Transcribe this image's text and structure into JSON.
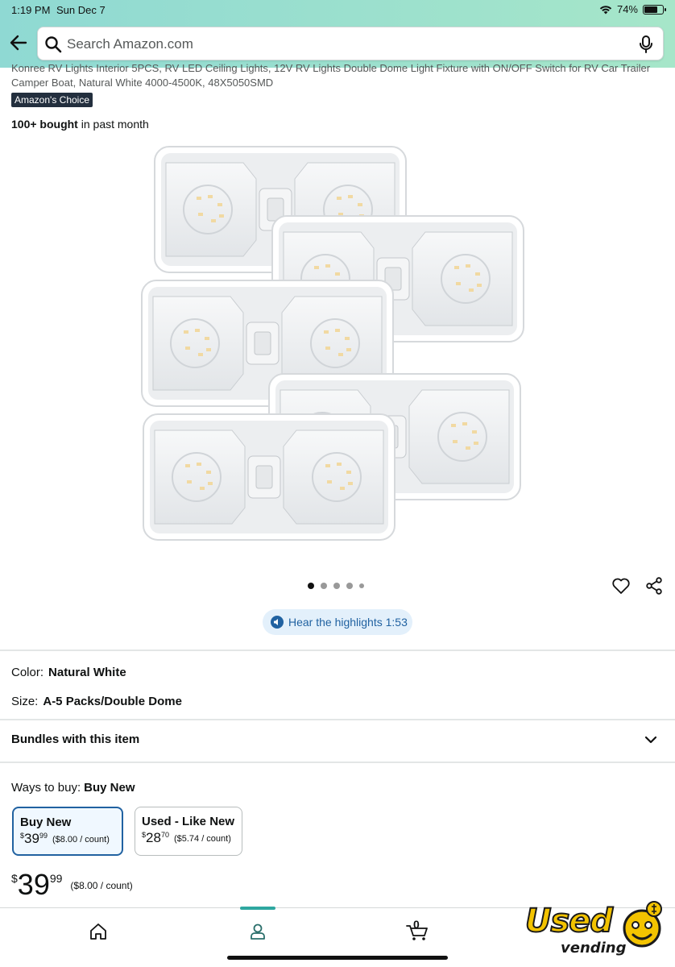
{
  "status_bar": {
    "time": "1:19 PM",
    "date": "Sun Dec 7",
    "battery": "74%",
    "battery_level": 0.74
  },
  "search": {
    "placeholder": "Search Amazon.com"
  },
  "product": {
    "title": "Konree RV Lights Interior 5PCS, RV LED Ceiling Lights, 12V RV Lights Double Dome Light Fixture with ON/OFF Switch for RV Car Trailer Camper Boat, Natural White 4000-4500K, 48X5050SMD",
    "badge": "Amazon's Choice",
    "bought_strong": "100+ bought",
    "bought_rest": " in past month",
    "highlights": "Hear the highlights 1:53",
    "image_count": 5,
    "image_active_index": 0
  },
  "variations": {
    "color_label": "Color:",
    "color_value": "Natural White",
    "size_label": "Size:",
    "size_value": "A-5 Packs/Double Dome"
  },
  "bundles": {
    "label": "Bundles with this item"
  },
  "ways_to_buy": {
    "label": "Ways to buy:",
    "selected": "Buy New",
    "options": [
      {
        "title": "Buy New",
        "currency": "$",
        "dollars": "39",
        "cents": "99",
        "per_unit": "($8.00 / count)"
      },
      {
        "title": "Used - Like New",
        "currency": "$",
        "dollars": "28",
        "cents": "70",
        "per_unit": "($5.74 / count)"
      }
    ]
  },
  "price": {
    "currency": "$",
    "dollars": "39",
    "cents": "99",
    "per_unit": "($8.00 / count)"
  },
  "bottom_nav": {
    "cart_count": "0",
    "icons": [
      "home-icon",
      "account-icon",
      "cart-icon"
    ]
  },
  "watermark": {
    "brand": "Used",
    "sub": "vending"
  },
  "colors": {
    "header_start": "#8fd9d3",
    "header_end": "#a6e6c9",
    "badge_bg": "#232f3e",
    "link_blue": "#2162a1",
    "selected_border": "#2162a1",
    "nav_accent": "#2ea7a0"
  }
}
